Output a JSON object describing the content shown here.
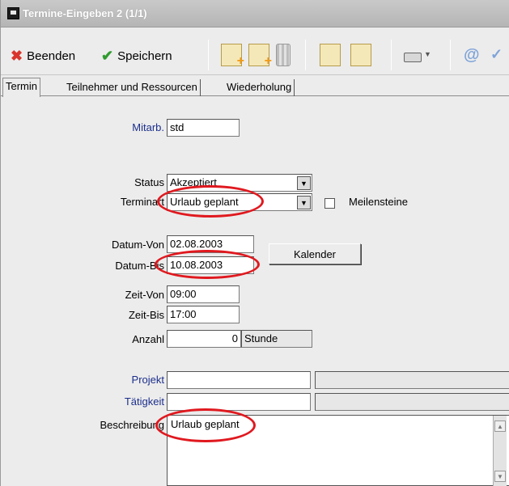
{
  "window": {
    "title": "Termine-Eingeben 2 (1/1)"
  },
  "toolbar": {
    "close_label": "Beenden",
    "save_label": "Speichern"
  },
  "tabs": [
    {
      "label": "Termin"
    },
    {
      "label": "Teilnehmer und Ressourcen"
    },
    {
      "label": "Wiederholung"
    }
  ],
  "form": {
    "mitarb": {
      "label": "Mitarb.",
      "value": "std"
    },
    "status": {
      "label": "Status",
      "value": "Akzeptiert"
    },
    "terminart": {
      "label": "Terminart",
      "value": "Urlaub geplant"
    },
    "meilensteine": {
      "label": "Meilensteine",
      "checked": false
    },
    "datum_von": {
      "label": "Datum-Von",
      "value": "02.08.2003"
    },
    "datum_bis": {
      "label": "Datum-Bis",
      "value": "10.08.2003"
    },
    "kalender_label": "Kalender",
    "zeit_von": {
      "label": "Zeit-Von",
      "value": "09:00"
    },
    "zeit_bis": {
      "label": "Zeit-Bis",
      "value": "17:00"
    },
    "anzahl": {
      "label": "Anzahl",
      "value": "0",
      "unit": "Stunde"
    },
    "projekt": {
      "label": "Projekt",
      "value": "",
      "extra": ""
    },
    "taetigkeit": {
      "label": "Tätigkeit",
      "value": "",
      "extra": ""
    },
    "beschreibung": {
      "label": "Beschreibung",
      "value": "Urlaub geplant"
    }
  },
  "colors": {
    "highlight": "#e0191f",
    "link_label": "#1c2f8c"
  }
}
